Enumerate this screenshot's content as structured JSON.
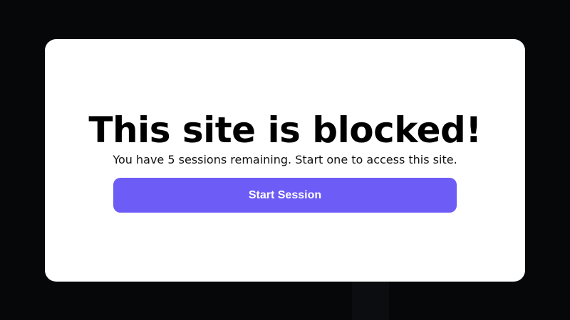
{
  "colors": {
    "background": "#060709",
    "card": "#ffffff",
    "accent": "#6e5cf6",
    "button_text": "#ffffff"
  },
  "blocked": {
    "headline": "This site is blocked!",
    "message": "You have 5 sessions remaining. Start one to access this site.",
    "start_button_label": "Start Session"
  }
}
